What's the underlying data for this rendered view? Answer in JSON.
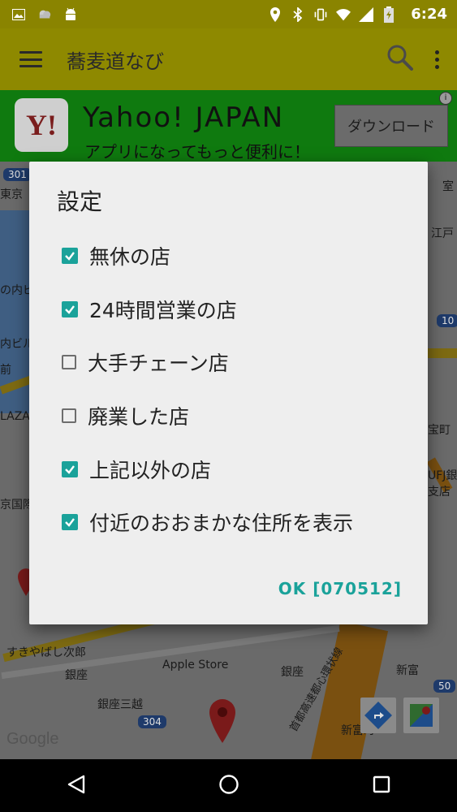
{
  "status_bar": {
    "time": "6:24",
    "left_icons": [
      "image-icon",
      "weather-icon",
      "android-icon"
    ],
    "right_icons": [
      "location-icon",
      "bluetooth-icon",
      "vibrate-icon",
      "wifi-icon",
      "signal-icon",
      "battery-icon"
    ]
  },
  "app_bar": {
    "title": "蕎麦道なび",
    "menu_icon": "hamburger-icon",
    "search_icon": "search-icon",
    "overflow_icon": "more-vert-icon"
  },
  "ad": {
    "title": "Yahoo! JAPAN",
    "subtitle": "アプリになってもっと便利に！",
    "button_label": "ダウンロード",
    "logo_text": "Y!",
    "info_label": "i"
  },
  "map": {
    "labels": [
      "東京",
      "の内ビ",
      "内ビル",
      "前",
      "LAZA",
      "京国際",
      "すきやばし次郎",
      "銀座",
      "Apple Store",
      "銀座三越",
      "銀座",
      "新富",
      "新富町",
      "首都高速都心環状線",
      "江戸",
      "室",
      "宝町",
      "UFJ銀",
      "支店",
      "Google"
    ],
    "shields": [
      "301",
      "10",
      "50",
      "304"
    ]
  },
  "dialog": {
    "title": "設定",
    "options": [
      {
        "label": "無休の店",
        "checked": true
      },
      {
        "label": "24時間営業の店",
        "checked": true
      },
      {
        "label": "大手チェーン店",
        "checked": false
      },
      {
        "label": "廃業した店",
        "checked": false
      },
      {
        "label": "上記以外の店",
        "checked": true
      },
      {
        "label": "付近のおおまかな住所を表示",
        "checked": true
      }
    ],
    "ok_label": "OK  [070512]"
  },
  "nav_bar": {
    "back": "back-icon",
    "home": "home-icon",
    "recents": "recents-icon"
  },
  "colors": {
    "accent": "#1aa29a",
    "appbar": "#8e8900",
    "ad_bg": "#0f7a0f"
  }
}
